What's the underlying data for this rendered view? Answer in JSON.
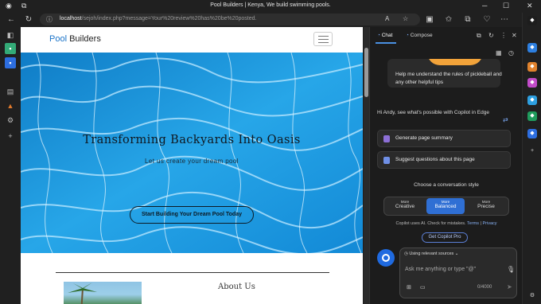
{
  "window": {
    "title": "Pool Builders | Kenya, We build swimming pools.",
    "minimize": "─",
    "maximize": "☐",
    "close": "✕"
  },
  "address_bar": {
    "host": "localhost",
    "path": "/sejoh/index.php?message=Your%20review%20has%20be%20posted."
  },
  "site": {
    "brand_accent": "Pool",
    "brand_rest": " Builders",
    "hero_title": "Transforming Backyards Into Oasis",
    "hero_subtitle": "Let us create your dream pool",
    "hero_button": "Start Building Your Dream Pool Today",
    "about_title": "About Us"
  },
  "copilot": {
    "tabs": [
      {
        "label": "Chat",
        "active": true
      },
      {
        "label": "Compose",
        "active": false
      }
    ],
    "suggestion": "Help me understand the rules of pickleball and any other helpful tips",
    "greeting": "Hi Andy, see what's possible with Copilot in Edge",
    "actions": [
      {
        "label": "Generate page summary"
      },
      {
        "label": "Suggest questions about this page"
      }
    ],
    "style_label": "Choose a conversation style",
    "styles": [
      {
        "top": "More",
        "label": "Creative",
        "active": false
      },
      {
        "top": "More",
        "label": "Balanced",
        "active": true
      },
      {
        "top": "More",
        "label": "Precise",
        "active": false
      }
    ],
    "disclaimer": "Copilot uses AI. Check for mistakes.",
    "terms": "Terms",
    "separator": "|",
    "privacy": "Privacy",
    "pro_button": "Get Copilot Pro",
    "sources": "Using relevant sources",
    "placeholder": "Ask me anything or type \"@\"",
    "counter": "0/4000"
  },
  "colors": {
    "accent": "#2f6fd4",
    "brand_blue": "#1a73c8",
    "water": "#1a90d8"
  }
}
